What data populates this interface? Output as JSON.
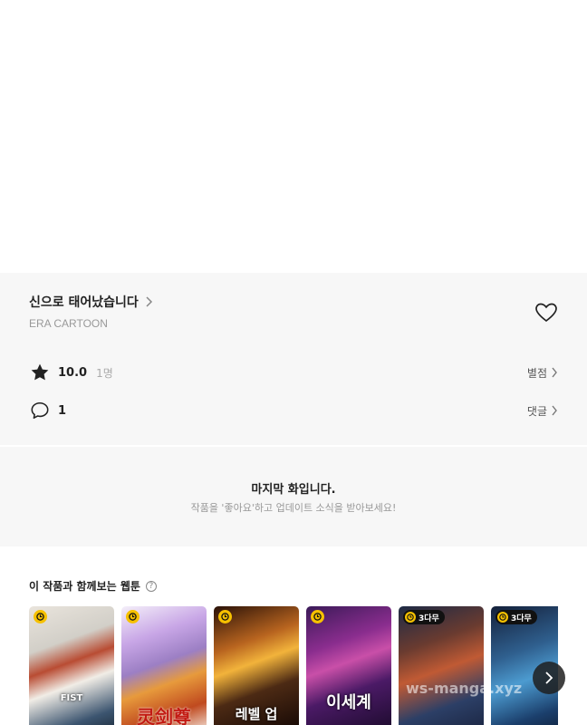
{
  "series": {
    "title": "신으로 태어났습니다",
    "author": "ERA CARTOON"
  },
  "rating": {
    "score": "10.0",
    "count": "1명",
    "link_label": "별점"
  },
  "comments": {
    "count": "1",
    "link_label": "댓글"
  },
  "end_notice": {
    "title": "마지막 화입니다.",
    "subtitle": "작품을 '좋아요'하고 업데이트 소식을 받아보세요!"
  },
  "recommendations": {
    "title": "이 작품과 함께보는 웹툰",
    "help_icon": "?",
    "cards": [
      {
        "cover_text": "FIST",
        "badge": ""
      },
      {
        "cover_text": "灵剑尊",
        "badge": ""
      },
      {
        "cover_text": "레벨 업",
        "badge": ""
      },
      {
        "cover_text": "이세계",
        "badge": ""
      },
      {
        "cover_text": "",
        "badge": "3다무"
      },
      {
        "cover_text": "",
        "badge": "3다무"
      }
    ]
  },
  "watermark": "ws-manga.xyz",
  "colors": {
    "accent_clock": "#f6c100",
    "panel_bg": "#f7f7f7"
  },
  "icons": [
    "chevron-right-icon",
    "heart-icon",
    "star-icon",
    "comment-icon",
    "question-icon",
    "clock-icon",
    "next-arrow-icon"
  ]
}
